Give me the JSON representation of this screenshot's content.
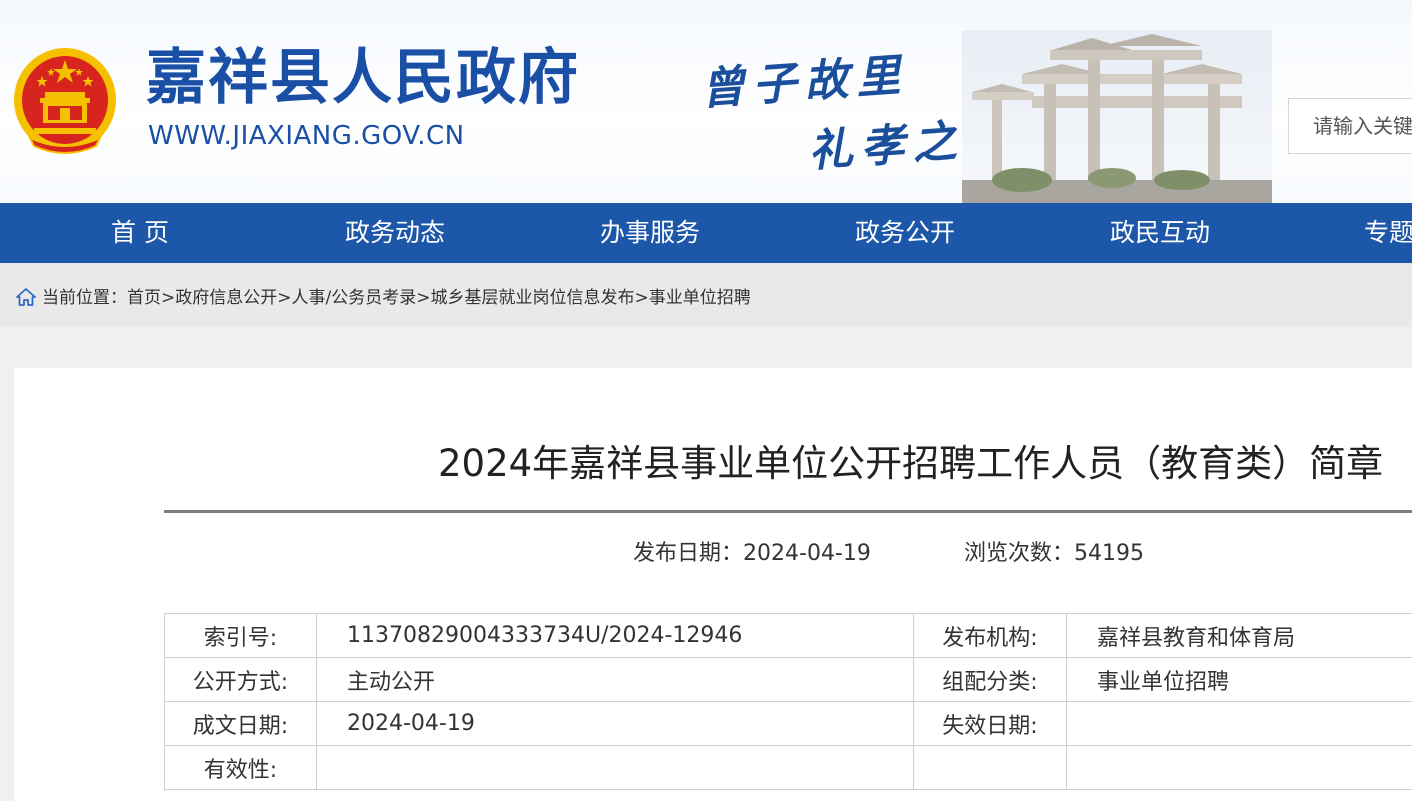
{
  "header": {
    "site_title": "嘉祥县人民政府",
    "site_url": "WWW.JIAXIANG.GOV.CN",
    "slogan_line1": "曾子故里",
    "slogan_line2": "礼孝之城",
    "search_placeholder": "请输入关键",
    "colors": {
      "brand_blue": "#1c57a9",
      "emblem_red": "#d7241f",
      "emblem_gold": "#f5c000"
    }
  },
  "nav": {
    "items": [
      {
        "label": "首 页"
      },
      {
        "label": "政务动态"
      },
      {
        "label": "办事服务"
      },
      {
        "label": "政务公开"
      },
      {
        "label": "政民互动"
      },
      {
        "label": "专题"
      }
    ]
  },
  "breadcrumb": {
    "icon": "home-icon",
    "prefix": "当前位置：",
    "items": [
      "首页",
      "政府信息公开",
      "人事/公务员考录",
      "城乡基层就业岗位信息发布",
      "事业单位招聘"
    ],
    "separator": ">"
  },
  "article": {
    "title": "2024年嘉祥县事业单位公开招聘工作人员（教育类）简章",
    "publish_date_label": "发布日期：",
    "publish_date": "2024-04-19",
    "views_label": "浏览次数：",
    "views": "54195"
  },
  "info_table": {
    "rows": [
      {
        "label1": "索引号:",
        "value1": "11370829004333734U/2024-12946",
        "label2": "发布机构:",
        "value2": "嘉祥县教育和体育局"
      },
      {
        "label1": "公开方式:",
        "value1": "主动公开",
        "label2": "组配分类:",
        "value2": "事业单位招聘"
      },
      {
        "label1": "成文日期:",
        "value1": "2024-04-19",
        "label2": "失效日期:",
        "value2": ""
      },
      {
        "label1": "有效性:",
        "value1": "",
        "label2": "",
        "value2": ""
      }
    ]
  }
}
